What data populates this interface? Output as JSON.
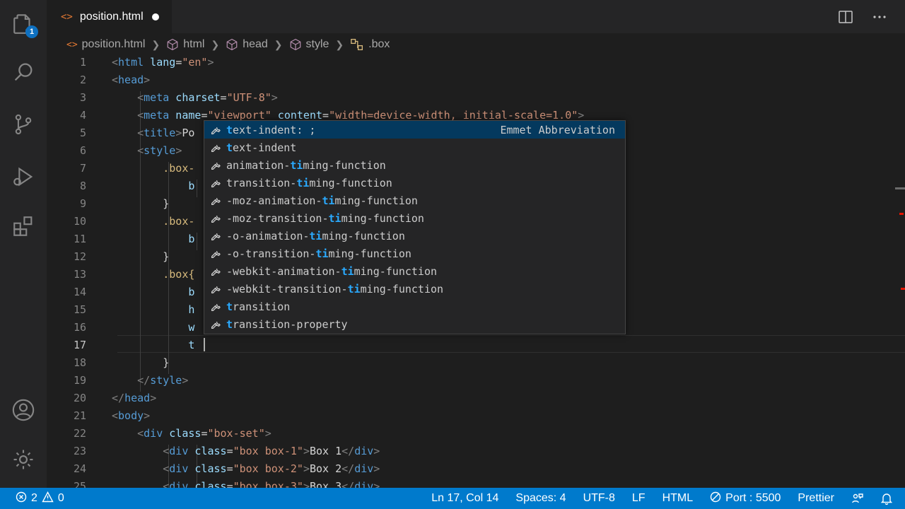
{
  "activity_bar": {
    "explorer_badge": "1",
    "icons": [
      "files-icon",
      "search-icon",
      "source-control-icon",
      "run-debug-icon",
      "extensions-icon",
      "account-icon",
      "settings-gear-icon"
    ]
  },
  "tab": {
    "label": "position.html",
    "dirty": true
  },
  "breadcrumb": {
    "file": "position.html",
    "items": [
      "html",
      "head",
      "style",
      ".box"
    ]
  },
  "editor": {
    "active_line": 17,
    "lines": [
      {
        "n": "1"
      },
      {
        "n": "2"
      },
      {
        "n": "3"
      },
      {
        "n": "4"
      },
      {
        "n": "5"
      },
      {
        "n": "6"
      },
      {
        "n": "7"
      },
      {
        "n": "8"
      },
      {
        "n": "9"
      },
      {
        "n": "10"
      },
      {
        "n": "11"
      },
      {
        "n": "12"
      },
      {
        "n": "13"
      },
      {
        "n": "14"
      },
      {
        "n": "15"
      },
      {
        "n": "16"
      },
      {
        "n": "17"
      },
      {
        "n": "18"
      },
      {
        "n": "19"
      },
      {
        "n": "20"
      },
      {
        "n": "21"
      },
      {
        "n": "22"
      },
      {
        "n": "23"
      },
      {
        "n": "24"
      },
      {
        "n": "25"
      }
    ],
    "code": {
      "l1_open": "<",
      "l1_tag": "html",
      "l1_attr": " lang",
      "l1_eq": "=",
      "l1_val": "\"en\"",
      "l1_close": ">",
      "l2": "head",
      "l3_tag": "meta",
      "l3_attr": " charset",
      "l3_val": "\"UTF-8\"",
      "l4_tag": "meta",
      "l4_attr1": " name",
      "l4_val1": "\"viewport\"",
      "l4_attr2": " content",
      "l4_val2": "\"width=device-width, initial-scale=1.0\"",
      "l5_tag": "title",
      "l5_text": "Po",
      "l6_tag": "style",
      "l7": ".box-",
      "l8": "b",
      "l9": "}",
      "l10": ".box-",
      "l11": "b",
      "l12": "}",
      "l13": ".box{",
      "l14": "b",
      "l15": "h",
      "l16": "w",
      "l17": "t",
      "l18": "}",
      "l19_tag": "style",
      "l20_tag": "head",
      "l21_tag": "body",
      "l22_tag": "div",
      "l22_attr": " class",
      "l22_val": "\"box-set\"",
      "l23_tag": "div",
      "l23_attr": " class",
      "l23_val": "\"box box-1\"",
      "l23_text": "Box 1",
      "l23_end": "div",
      "l24_tag": "div",
      "l24_attr": " class",
      "l24_val": "\"box box-2\"",
      "l24_text": "Box 2",
      "l24_end": "div",
      "l25_tag": "div",
      "l25_attr": " class",
      "l25_val": "\"box box-3\"",
      "l25_text": "Box 3",
      "l25_end": "div"
    }
  },
  "suggestions": {
    "detail": "Emmet Abbreviation",
    "items": [
      {
        "pre": "",
        "hl": "t",
        "post": "ext-indent: ;",
        "selected": true
      },
      {
        "pre": "",
        "hl": "t",
        "post": "ext-indent"
      },
      {
        "pre": "animation-",
        "hl": "ti",
        "post": "ming-function"
      },
      {
        "pre": "transition-",
        "hl": "ti",
        "post": "ming-function"
      },
      {
        "pre": "-moz-animation-",
        "hl": "ti",
        "post": "ming-function"
      },
      {
        "pre": "-moz-transition-",
        "hl": "ti",
        "post": "ming-function"
      },
      {
        "pre": "-o-animation-",
        "hl": "ti",
        "post": "ming-function"
      },
      {
        "pre": "-o-transition-",
        "hl": "ti",
        "post": "ming-function"
      },
      {
        "pre": "-webkit-animation-",
        "hl": "ti",
        "post": "ming-function"
      },
      {
        "pre": "-webkit-transition-",
        "hl": "ti",
        "post": "ming-function"
      },
      {
        "pre": "",
        "hl": "t",
        "post": "ransition"
      },
      {
        "pre": "",
        "hl": "t",
        "post": "ransition-property"
      }
    ]
  },
  "status_bar": {
    "errors": "2",
    "warnings": "0",
    "position": "Ln 17, Col 14",
    "spaces": "Spaces: 4",
    "encoding": "UTF-8",
    "eol": "LF",
    "language": "HTML",
    "port": "Port : 5500",
    "formatter": "Prettier"
  },
  "colors": {
    "accent": "#007acc",
    "selection": "#04395e",
    "match": "#2aaaff",
    "html_icon": "#e37933"
  }
}
